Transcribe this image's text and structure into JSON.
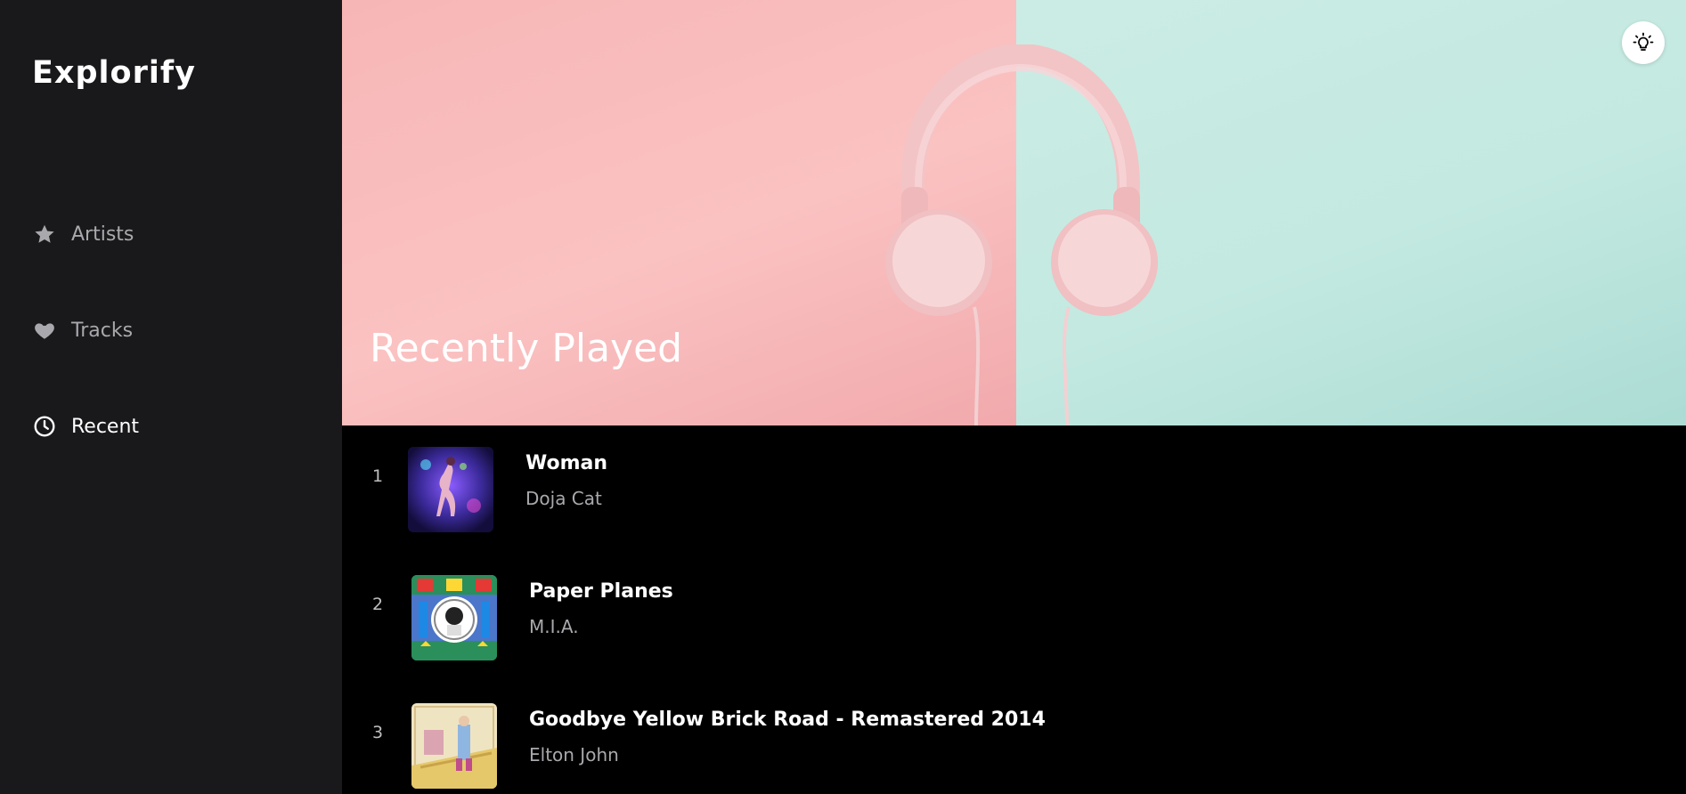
{
  "app": {
    "title": "Explorify"
  },
  "sidebar": {
    "items": [
      {
        "label": "Artists",
        "icon": "star-icon",
        "active": false
      },
      {
        "label": "Tracks",
        "icon": "heart-icon",
        "active": false
      },
      {
        "label": "Recent",
        "icon": "clock-icon",
        "active": true
      }
    ]
  },
  "hero": {
    "title": "Recently Played",
    "theme_toggle_icon": "lightbulb-icon"
  },
  "tracks": [
    {
      "number": "1",
      "title": "Woman",
      "artist": "Doja Cat"
    },
    {
      "number": "2",
      "title": "Paper Planes",
      "artist": "M.I.A."
    },
    {
      "number": "3",
      "title": "Goodbye Yellow Brick Road - Remastered 2014",
      "artist": "Elton John"
    }
  ],
  "colors": {
    "sidebar_bg": "#19181b",
    "main_bg": "#000000",
    "hero_pink": "#fbc2c2",
    "hero_mint": "#c3e9e1",
    "text_muted": "#a9a9ad"
  }
}
